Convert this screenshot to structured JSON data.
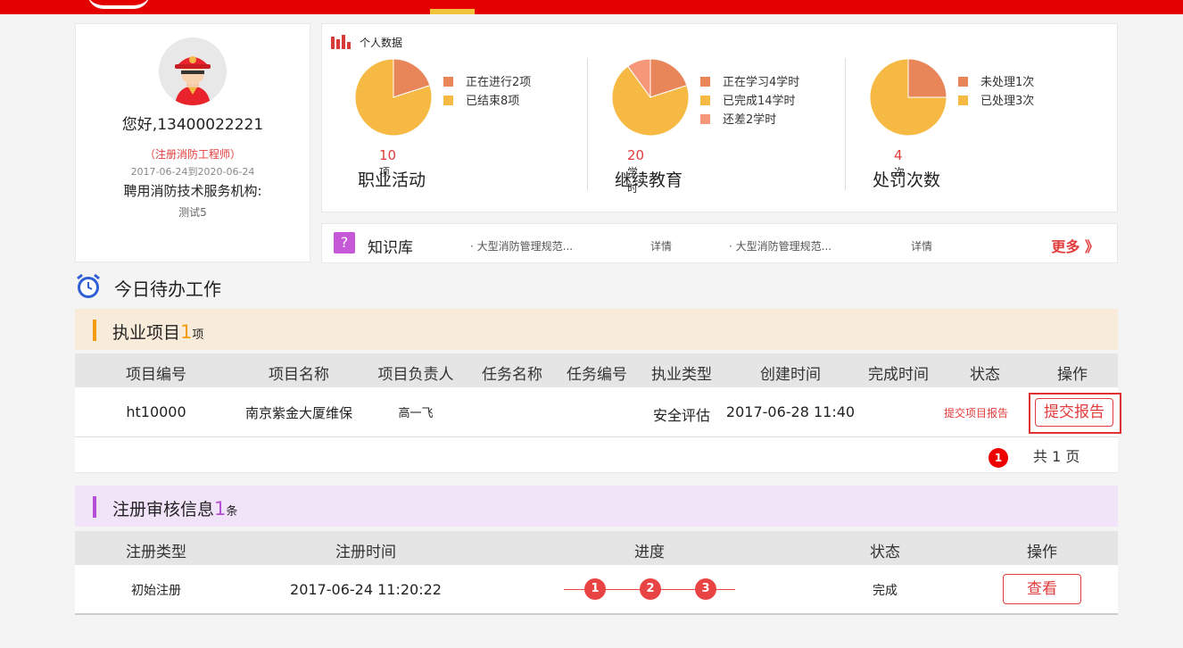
{
  "profile": {
    "greeting": "您好,13400022221",
    "role": "（注册消防工程师）",
    "date_range": "2017-06-24到2020-06-24",
    "org_label": "聘用消防技术服务机构:",
    "org_value": "测试5"
  },
  "stats": {
    "title": "个人数据",
    "colors": {
      "orange": "#e8865a",
      "yellow": "#f5b944",
      "salmon": "#f6977a"
    },
    "blocks": [
      {
        "value": "10",
        "unit": "项",
        "label": "职业活动",
        "legend": [
          {
            "text": "正在进行2项",
            "color": "#e8865a",
            "value": 2
          },
          {
            "text": "已结束8项",
            "color": "#f5b944",
            "value": 8
          }
        ]
      },
      {
        "value": "20",
        "unit": "学时",
        "label": "继续教育",
        "legend": [
          {
            "text": "正在学习4学时",
            "color": "#e8865a",
            "value": 4
          },
          {
            "text": "已完成14学时",
            "color": "#f5b944",
            "value": 14
          },
          {
            "text": "还差2学时",
            "color": "#f6977a",
            "value": 2
          }
        ]
      },
      {
        "value": "4",
        "unit": "次",
        "label": "处罚次数",
        "legend": [
          {
            "text": "未处理1次",
            "color": "#e8865a",
            "value": 1
          },
          {
            "text": "已处理3次",
            "color": "#f5b944",
            "value": 3
          }
        ]
      }
    ]
  },
  "knowledge": {
    "icon": "?",
    "title": "知识库",
    "items": [
      {
        "text": "· 大型消防管理规范...",
        "detail": "详情"
      },
      {
        "text": "· 大型消防管理规范...",
        "detail": "详情"
      }
    ],
    "more": "更多 》"
  },
  "todo": {
    "title": "今日待办工作"
  },
  "projects": {
    "title": "执业项目",
    "count": "1",
    "unit": "项",
    "bar_color": "#f49b12",
    "columns": [
      "项目编号",
      "项目名称",
      "项目负责人",
      "任务名称",
      "任务编号",
      "执业类型",
      "创建时间",
      "完成时间",
      "状态",
      "操作"
    ],
    "row": {
      "id": "ht10000",
      "name": "南京紫金大厦维保",
      "manager": "高一飞",
      "task_name": "",
      "task_id": "",
      "type": "安全评估",
      "created": "2017-06-28 11:40",
      "finished": "",
      "status_link": "提交项目报告",
      "action": "提交报告"
    },
    "pager": {
      "current": "1",
      "total_text": "共 1 页"
    }
  },
  "registration": {
    "title": "注册审核信息",
    "count": "1",
    "unit": "条",
    "bar_color": "#b44fd6",
    "columns": [
      "注册类型",
      "注册时间",
      "进度",
      "状态",
      "操作"
    ],
    "row": {
      "type": "初始注册",
      "time": "2017-06-24 11:20:22",
      "steps": [
        "1",
        "2",
        "3"
      ],
      "status": "完成",
      "action": "查看"
    }
  }
}
